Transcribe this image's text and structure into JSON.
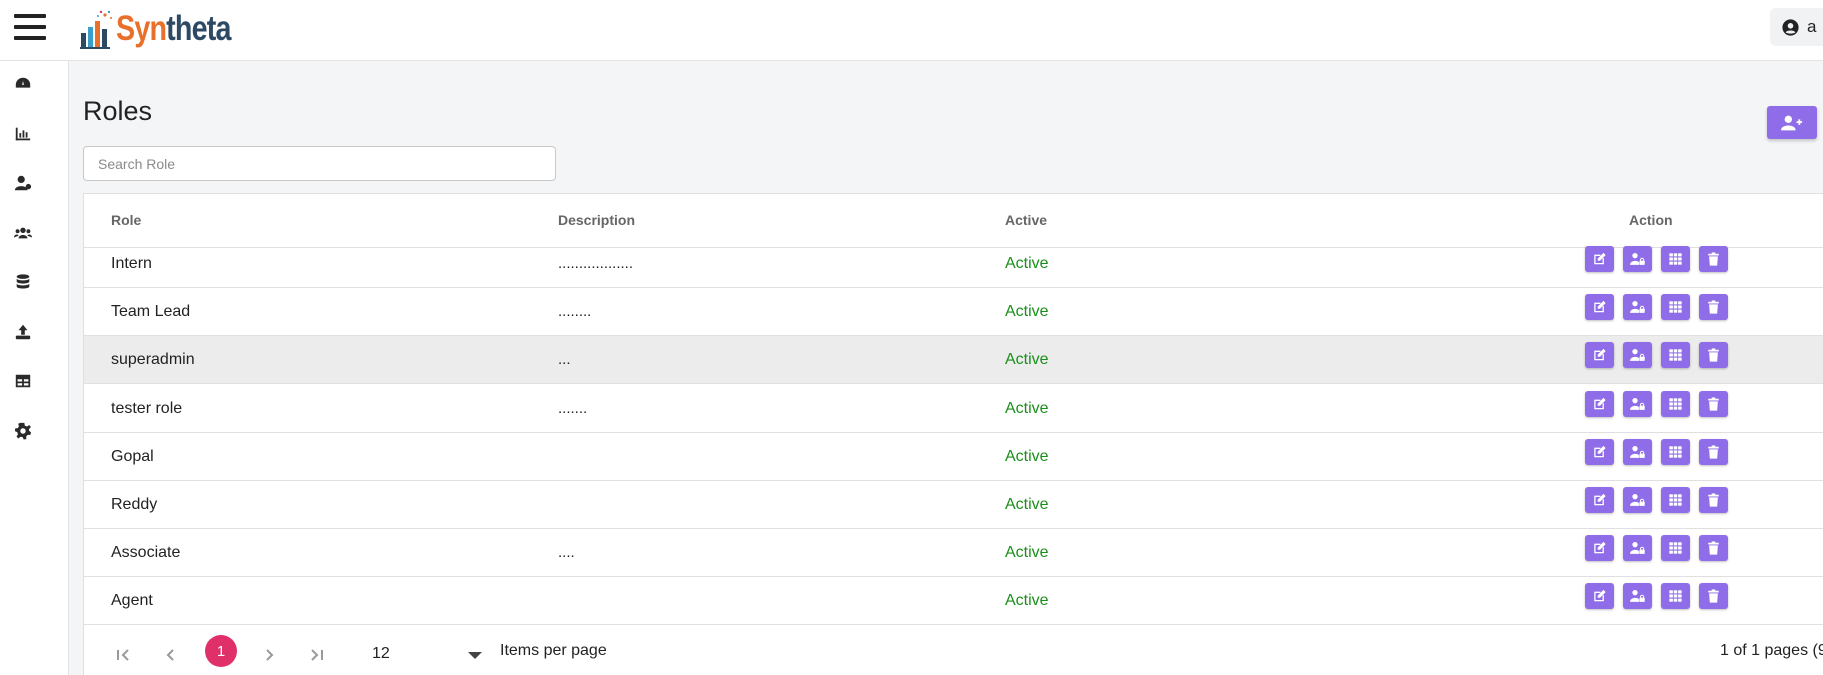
{
  "app": {
    "brand_part1": "Syn",
    "brand_part2": "theta",
    "brand_colors": {
      "orange": "#e8702a",
      "navy": "#2c4a63"
    },
    "user_initial": "a"
  },
  "sidebar": {
    "items": [
      {
        "name": "dashboard",
        "icon": "dashboard-gauge-icon"
      },
      {
        "name": "reports",
        "icon": "bar-chart-icon"
      },
      {
        "name": "user-management",
        "icon": "user-gear-icon"
      },
      {
        "name": "users",
        "icon": "users-group-icon"
      },
      {
        "name": "database",
        "icon": "database-icon"
      },
      {
        "name": "upload",
        "icon": "upload-icon"
      },
      {
        "name": "tables",
        "icon": "table-icon"
      },
      {
        "name": "settings",
        "icon": "gear-icon"
      }
    ]
  },
  "page": {
    "title": "Roles",
    "add_button_icon": "add-user-icon",
    "accent_color": "#8f6de8"
  },
  "search": {
    "placeholder": "Search Role",
    "value": ""
  },
  "table": {
    "columns": {
      "role": "Role",
      "description": "Description",
      "active": "Active",
      "action": "Action"
    },
    "rows": [
      {
        "role": "Intern",
        "description": "..................",
        "status": "Active"
      },
      {
        "role": "Team Lead",
        "description": "........",
        "status": "Active"
      },
      {
        "role": "superadmin",
        "description": "...",
        "status": "Active"
      },
      {
        "role": "tester role",
        "description": ".......",
        "status": "Active"
      },
      {
        "role": "Gopal",
        "description": "",
        "status": "Active"
      },
      {
        "role": "Reddy",
        "description": "",
        "status": "Active"
      },
      {
        "role": "Associate",
        "description": "....",
        "status": "Active"
      },
      {
        "role": "Agent",
        "description": "",
        "status": "Active"
      }
    ],
    "row_action_icons": [
      "edit-icon",
      "user-lock-icon",
      "grid-icon",
      "trash-icon"
    ],
    "status_color": "#1a8f1a"
  },
  "pagination": {
    "current_page": "1",
    "items_per_page": "12",
    "items_per_page_label": "Items per page",
    "range_text": "1 of 1 pages (9"
  }
}
